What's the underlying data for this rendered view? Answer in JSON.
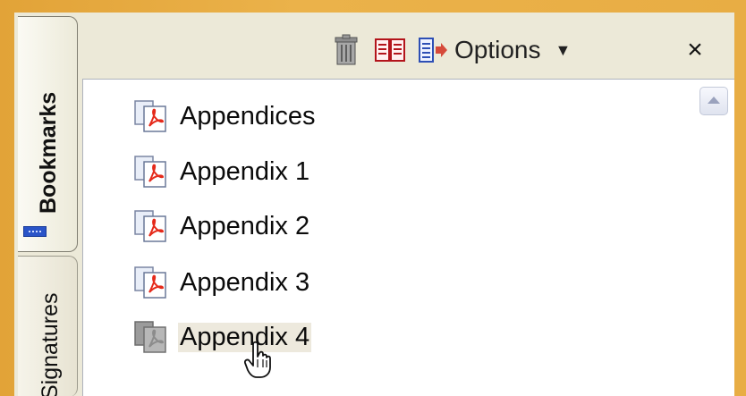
{
  "panel": {
    "tabs": [
      {
        "label": "Bookmarks",
        "active": true
      },
      {
        "label": "Signatures",
        "active": false
      }
    ],
    "toolbar": {
      "delete_icon": "trash-icon",
      "bookmark_icon": "open-book-icon",
      "expand_icon": "expand-bookmark-icon",
      "options_label": "Options",
      "options_caret": "▼",
      "close_label": "×"
    },
    "bookmarks": [
      {
        "label": "Appendices",
        "icon": "pdf-page-icon",
        "selected": false
      },
      {
        "label": "Appendix 1",
        "icon": "pdf-page-icon",
        "selected": false
      },
      {
        "label": "Appendix 2",
        "icon": "pdf-page-icon",
        "selected": false
      },
      {
        "label": "Appendix 3",
        "icon": "pdf-page-icon",
        "selected": false
      },
      {
        "label": "Appendix 4",
        "icon": "pdf-page-gray-icon",
        "selected": true
      }
    ]
  },
  "colors": {
    "frame": "#e8ad44",
    "panel_bg": "#ece9d8",
    "tab_grip": "#2a54c8",
    "selection_bg": "#ede9dd",
    "pdf_red": "#e52a1b"
  }
}
